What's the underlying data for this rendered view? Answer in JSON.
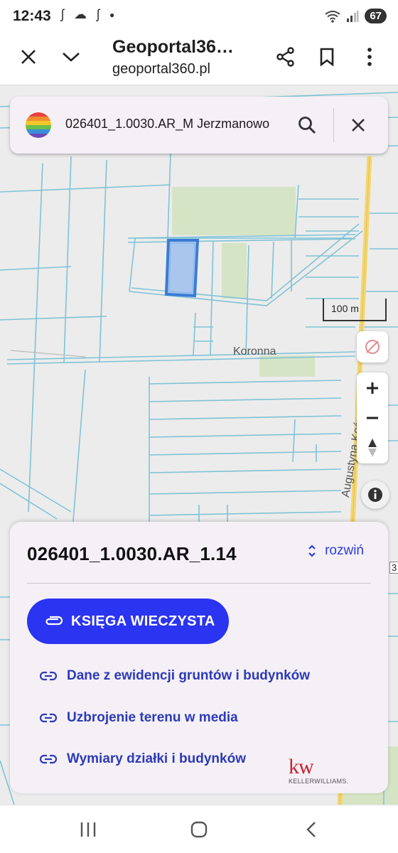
{
  "status_bar": {
    "time": "12:43",
    "battery": "67",
    "icons": [
      "app-icon-1",
      "cloud-icon",
      "app-icon-2",
      "dot-icon",
      "wifi-icon",
      "signal-icon"
    ]
  },
  "browser": {
    "title": "Geoportal36…",
    "url": "geoportal360.pl"
  },
  "search": {
    "query": "026401_1.0030.AR_M Jerzmanowo"
  },
  "map": {
    "place_label": "Koronna",
    "road_label": "Augustyna Kośnego",
    "scale_label": "100 m",
    "edge_label": "3",
    "colors": {
      "parcel_lines": "#7fc3d6",
      "road": "#f5d76e",
      "selected_parcel": "#3a7bd5",
      "green_area": "#d6e4c6"
    }
  },
  "panel": {
    "parcel_id": "026401_1.0030.AR_1.14",
    "expand_label": "rozwiń",
    "primary_button": "KSIĘGA WIECZYSTA",
    "links": [
      "Dane z ewidencji gruntów i budynków",
      "Uzbrojenie terenu w media",
      "Wymiary działki i budynków"
    ],
    "brand": {
      "main": "kw",
      "sub": "KELLERWILLIAMS."
    },
    "accent_color": "#2b34f0"
  }
}
